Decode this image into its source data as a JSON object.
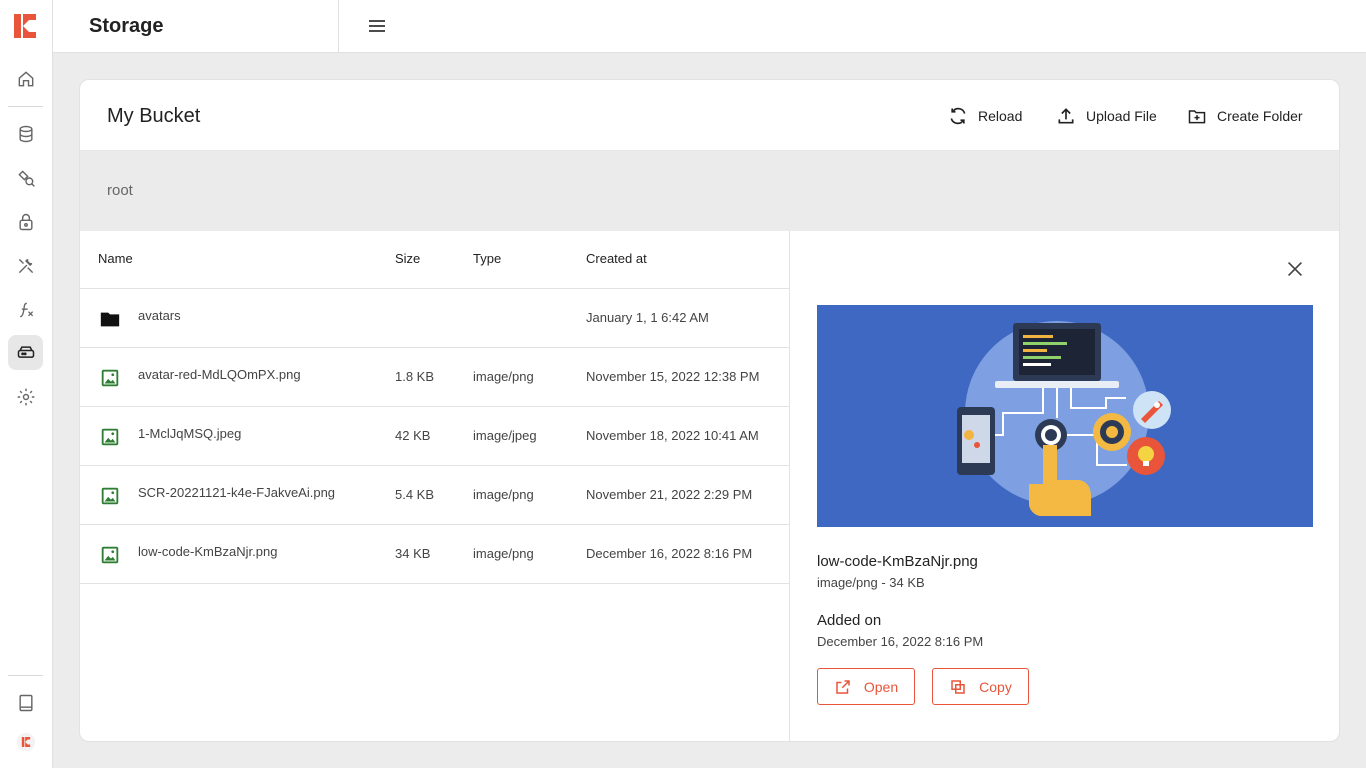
{
  "colors": {
    "accent": "#e8553a",
    "preview_bg": "#3e68c1",
    "folder_icon": "#111111",
    "image_icon": "#2e7d32"
  },
  "sidebar": {
    "items": [
      {
        "icon": "home-icon"
      },
      {
        "icon": "database-icon"
      },
      {
        "icon": "api-icon"
      },
      {
        "icon": "lock-icon"
      },
      {
        "icon": "tools-icon"
      },
      {
        "icon": "function-icon"
      },
      {
        "icon": "storage-icon",
        "active": true
      },
      {
        "icon": "gear-icon"
      }
    ],
    "bottom": [
      {
        "icon": "book-icon"
      },
      {
        "icon": "avatar-logo-icon"
      }
    ]
  },
  "header": {
    "title": "Storage"
  },
  "bucket": {
    "title": "My Bucket",
    "actions": {
      "reload": "Reload",
      "upload": "Upload File",
      "create_folder": "Create Folder"
    },
    "breadcrumb": "root"
  },
  "table": {
    "columns": {
      "name": "Name",
      "size": "Size",
      "type": "Type",
      "created": "Created at"
    },
    "rows": [
      {
        "kind": "folder",
        "name": "avatars",
        "size": "",
        "type": "",
        "created": "January 1, 1 6:42 AM"
      },
      {
        "kind": "image",
        "name": "avatar-red-MdLQOmPX.png",
        "size": "1.8 KB",
        "type": "image/png",
        "created": "November 15, 2022 12:38 PM"
      },
      {
        "kind": "image",
        "name": "1-MclJqMSQ.jpeg",
        "size": "42 KB",
        "type": "image/jpeg",
        "created": "November 18, 2022 10:41 AM"
      },
      {
        "kind": "image",
        "name": "SCR-20221121-k4e-FJakveAi.png",
        "size": "5.4 KB",
        "type": "image/png",
        "created": "November 21, 2022 2:29 PM"
      },
      {
        "kind": "image",
        "name": "low-code-KmBzaNjr.png",
        "size": "34 KB",
        "type": "image/png",
        "created": "December 16, 2022 8:16 PM"
      }
    ]
  },
  "details": {
    "file_name": "low-code-KmBzaNjr.png",
    "meta": "image/png - 34 KB",
    "added_label": "Added on",
    "added_value": "December 16, 2022 8:16 PM",
    "open_label": "Open",
    "copy_label": "Copy"
  }
}
